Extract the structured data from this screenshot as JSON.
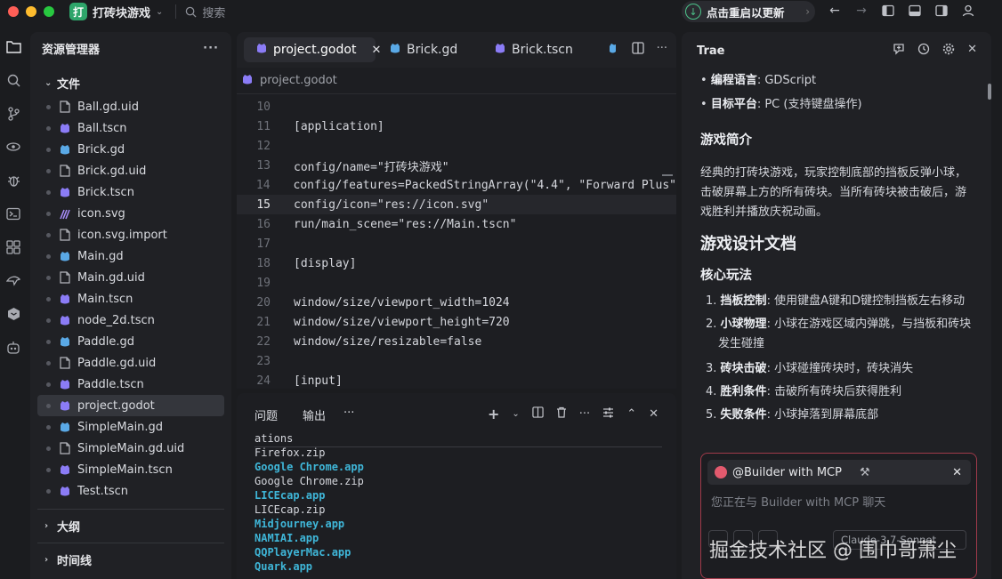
{
  "titlebar": {
    "app_badge": "打",
    "app_name": "打砖块游戏",
    "search_placeholder": "搜索",
    "restart_label": "点击重启以更新"
  },
  "colors": {
    "close": "#ff5f57",
    "minimize": "#febc2e",
    "maximize": "#28c840",
    "accent_green": "#2ea56a",
    "link_cyan": "#3fb6d8",
    "godot_purple": "#8b7cf6",
    "godot_blue": "#5aa9e6"
  },
  "explorer": {
    "title": "资源管理器",
    "more": "···",
    "files_section": "文件",
    "files": [
      {
        "name": "Ball.gd.uid",
        "icon": "file-icon"
      },
      {
        "name": "Ball.tscn",
        "icon": "godot-scene-icon"
      },
      {
        "name": "Brick.gd",
        "icon": "godot-script-icon"
      },
      {
        "name": "Brick.gd.uid",
        "icon": "file-icon"
      },
      {
        "name": "Brick.tscn",
        "icon": "godot-scene-icon"
      },
      {
        "name": "icon.svg",
        "icon": "svg-icon"
      },
      {
        "name": "icon.svg.import",
        "icon": "file-icon"
      },
      {
        "name": "Main.gd",
        "icon": "godot-script-icon"
      },
      {
        "name": "Main.gd.uid",
        "icon": "file-icon"
      },
      {
        "name": "Main.tscn",
        "icon": "godot-scene-icon"
      },
      {
        "name": "node_2d.tscn",
        "icon": "godot-scene-icon"
      },
      {
        "name": "Paddle.gd",
        "icon": "godot-script-icon"
      },
      {
        "name": "Paddle.gd.uid",
        "icon": "file-icon"
      },
      {
        "name": "Paddle.tscn",
        "icon": "godot-scene-icon"
      },
      {
        "name": "project.godot",
        "icon": "godot-scene-icon",
        "selected": true
      },
      {
        "name": "SimpleMain.gd",
        "icon": "godot-script-icon"
      },
      {
        "name": "SimpleMain.gd.uid",
        "icon": "file-icon"
      },
      {
        "name": "SimpleMain.tscn",
        "icon": "godot-scene-icon"
      },
      {
        "name": "Test.tscn",
        "icon": "godot-scene-icon"
      }
    ],
    "outline_section": "大纲",
    "timeline_section": "时间线"
  },
  "editor": {
    "tabs": [
      {
        "label": "project.godot",
        "active": true
      },
      {
        "label": "Brick.gd",
        "active": false
      },
      {
        "label": "Brick.tscn",
        "active": false
      }
    ],
    "breadcrumb": "project.godot",
    "lines": [
      {
        "n": "10",
        "t": ""
      },
      {
        "n": "11",
        "t": "[application]"
      },
      {
        "n": "12",
        "t": ""
      },
      {
        "n": "13",
        "t": "config/name=\"打砖块游戏\""
      },
      {
        "n": "14",
        "t": "config/features=PackedStringArray(\"4.4\", \"Forward Plus\""
      },
      {
        "n": "15",
        "t": "config/icon=\"res://icon.svg\"",
        "current": true
      },
      {
        "n": "16",
        "t": "run/main_scene=\"res://Main.tscn\""
      },
      {
        "n": "17",
        "t": ""
      },
      {
        "n": "18",
        "t": "[display]"
      },
      {
        "n": "19",
        "t": ""
      },
      {
        "n": "20",
        "t": "window/size/viewport_width=1024"
      },
      {
        "n": "21",
        "t": "window/size/viewport_height=720"
      },
      {
        "n": "22",
        "t": "window/size/resizable=false"
      },
      {
        "n": "23",
        "t": ""
      },
      {
        "n": "24",
        "t": "[input]"
      }
    ]
  },
  "panel": {
    "tabs": [
      "问题",
      "输出",
      "···"
    ],
    "terminal": [
      {
        "t": "ations",
        "app": false
      },
      {
        "t": "Firefox.zip",
        "app": false
      },
      {
        "t": "Google Chrome.app",
        "app": true
      },
      {
        "t": "Google Chrome.zip",
        "app": false
      },
      {
        "t": "LICEcap.app",
        "app": true
      },
      {
        "t": "LICEcap.zip",
        "app": false
      },
      {
        "t": "Midjourney.app",
        "app": true
      },
      {
        "t": "NAMIAI.app",
        "app": true
      },
      {
        "t": "QQPlayerMac.app",
        "app": true
      },
      {
        "t": "Quark.app",
        "app": true
      }
    ]
  },
  "chat": {
    "title": "Trae",
    "lang_label": "编程语言",
    "lang_value": ": GDScript",
    "platform_label": "目标平台",
    "platform_value": ": PC (支持键盘操作)",
    "intro_heading": "游戏简介",
    "intro_text": "经典的打砖块游戏，玩家控制底部的挡板反弹小球，击破屏幕上方的所有砖块。当所有砖块被击破后，游戏胜利并播放庆祝动画。",
    "doc_heading": "游戏设计文档",
    "core_heading": "核心玩法",
    "items": [
      {
        "label": "挡板控制",
        "text": ": 使用键盘A键和D键控制挡板左右移动"
      },
      {
        "label": "小球物理",
        "text": ": 小球在游戏区域内弹跳，与挡板和砖块发生碰撞"
      },
      {
        "label": "砖块击破",
        "text": ": 小球碰撞砖块时，砖块消失"
      },
      {
        "label": "胜利条件",
        "text": ": 击破所有砖块后获得胜利"
      },
      {
        "label": "失败条件",
        "text": ": 小球掉落到屏幕底部"
      }
    ],
    "agent": "@Builder with MCP",
    "placeholder": "您正在与 Builder with MCP 聊天",
    "model": "Claude-3.7-Sonnet"
  },
  "watermark": "掘金技术社区 @ 围巾哥萧尘"
}
